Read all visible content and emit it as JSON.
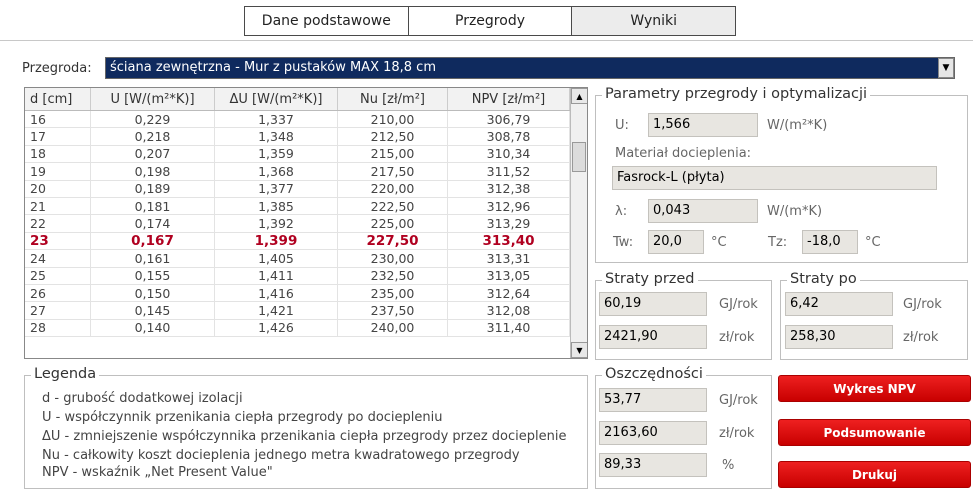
{
  "tabs": [
    "Dane podstawowe",
    "Przegrody",
    "Wyniki"
  ],
  "przegroda": {
    "label": "Przegroda:",
    "value": "ściana zewnętrzna - Mur z pustaków MAX 18,8 cm"
  },
  "table": {
    "headers": [
      "d [cm]",
      "U [W/(m²*K)]",
      "ΔU [W/(m²*K)]",
      "Nu [zł/m²]",
      "NPV [zł/m²]"
    ],
    "rows": [
      [
        "16",
        "0,229",
        "1,337",
        "210,00",
        "306,79"
      ],
      [
        "17",
        "0,218",
        "1,348",
        "212,50",
        "308,78"
      ],
      [
        "18",
        "0,207",
        "1,359",
        "215,00",
        "310,34"
      ],
      [
        "19",
        "0,198",
        "1,368",
        "217,50",
        "311,52"
      ],
      [
        "20",
        "0,189",
        "1,377",
        "220,00",
        "312,38"
      ],
      [
        "21",
        "0,181",
        "1,385",
        "222,50",
        "312,96"
      ],
      [
        "22",
        "0,174",
        "1,392",
        "225,00",
        "313,29"
      ],
      [
        "23",
        "0,167",
        "1,399",
        "227,50",
        "313,40"
      ],
      [
        "24",
        "0,161",
        "1,405",
        "230,00",
        "313,31"
      ],
      [
        "25",
        "0,155",
        "1,411",
        "232,50",
        "313,05"
      ],
      [
        "26",
        "0,150",
        "1,416",
        "235,00",
        "312,64"
      ],
      [
        "27",
        "0,145",
        "1,421",
        "237,50",
        "312,08"
      ],
      [
        "28",
        "0,140",
        "1,426",
        "240,00",
        "311,40"
      ]
    ],
    "highlighted_row": "23"
  },
  "legend": {
    "title": "Legenda",
    "lines": [
      "d - grubość dodatkowej izolacji",
      "U - współczynnik przenikania ciepła przegrody po dociepleniu",
      "ΔU - zmniejszenie współczynnika przenikania ciepła przegrody przez docieplenie",
      "Nu - całkowity koszt docieplenia jednego metra kwadratowego przegrody",
      "NPV - wskaźnik „Net Present Value\""
    ]
  },
  "params": {
    "title": "Parametry przegrody i optymalizacji",
    "u_label": "U:",
    "u_value": "1,566",
    "u_unit": "W/(m²*K)",
    "material_label": "Materiał docieplenia:",
    "material_value": "Fasrock-L (płyta)",
    "lambda_label": "λ:",
    "lambda_value": "0,043",
    "lambda_unit": "W/(m*K)",
    "tw_label": "Tw:",
    "tw_value": "20,0",
    "tw_unit": "°C",
    "tz_label": "Tz:",
    "tz_value": "-18,0",
    "tz_unit": "°C"
  },
  "straty_przed": {
    "title": "Straty przed",
    "gj": "60,19",
    "gj_unit": "GJ/rok",
    "zl": "2421,90",
    "zl_unit": "zł/rok"
  },
  "straty_po": {
    "title": "Straty po",
    "gj": "6,42",
    "gj_unit": "GJ/rok",
    "zl": "258,30",
    "zl_unit": "zł/rok"
  },
  "oszczednosci": {
    "title": "Oszczędności",
    "gj": "53,77",
    "gj_unit": "GJ/rok",
    "zl": "2163,60",
    "zl_unit": "zł/rok",
    "pct": "89,33",
    "pct_unit": "%"
  },
  "buttons": {
    "wykres": "Wykres NPV",
    "podsumowanie": "Podsumowanie",
    "drukuj": "Drukuj"
  }
}
